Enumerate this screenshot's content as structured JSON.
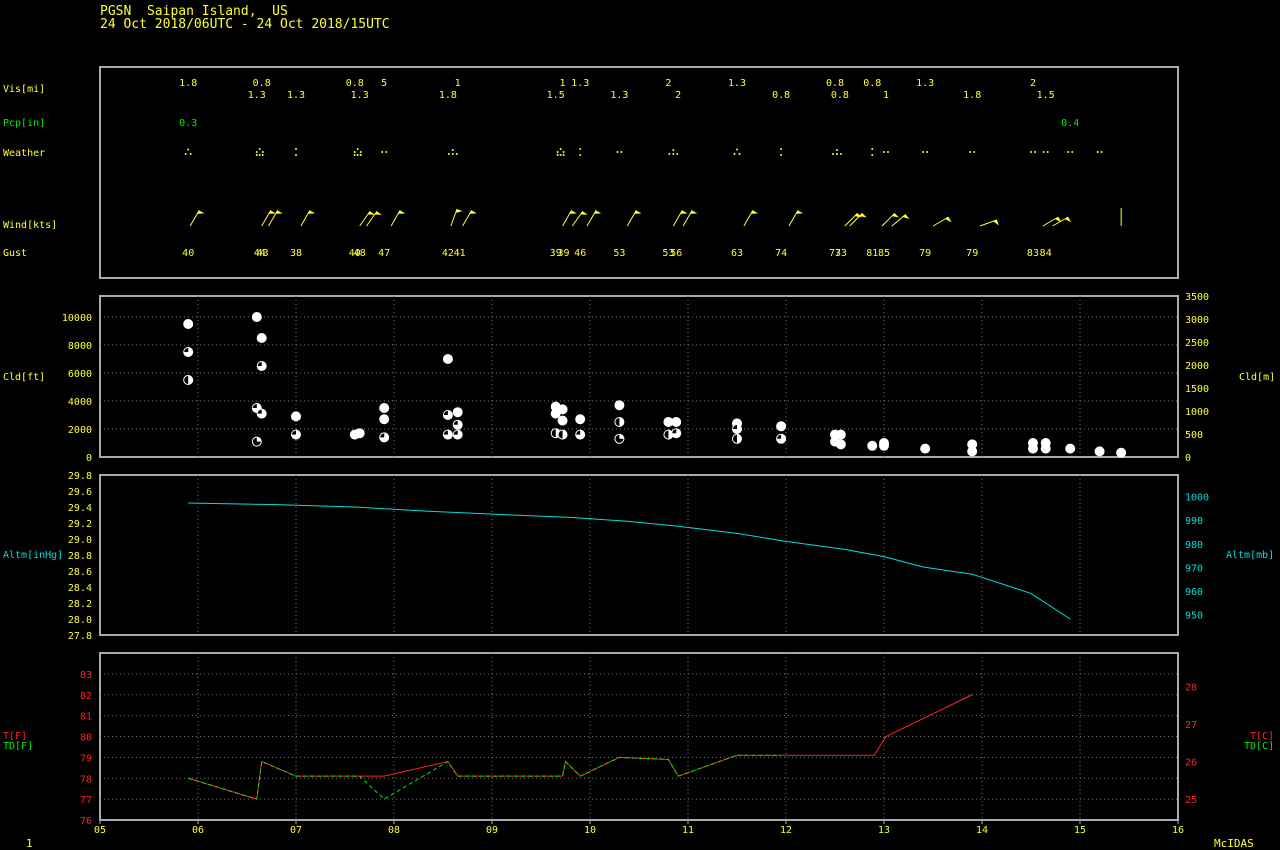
{
  "header": {
    "station_line": "PGSN  Saipan Island,  US",
    "time_line": "24 Oct 2018/06UTC - 24 Oct 2018/15UTC"
  },
  "footer": {
    "left": "1",
    "right": "McIDAS"
  },
  "colors": {
    "axis_text": "#ffff33",
    "frame": "#aaaaaa",
    "grid": "#777777",
    "precip": "#00ee00",
    "altimeter": "#00dddd",
    "temperature": "#ff2222",
    "dewpoint": "#00ee00",
    "cloud": "#ffffff"
  },
  "x_axis": {
    "range": [
      5,
      16
    ],
    "ticks": [
      "05",
      "06",
      "07",
      "08",
      "09",
      "10",
      "11",
      "12",
      "13",
      "14",
      "15",
      "16"
    ]
  },
  "chart_data": [
    {
      "type": "table",
      "name": "surface-observations",
      "labels": {
        "vis": "Vis[mi]",
        "pcp": "Pcp[in]",
        "weather": "Weather",
        "wind": "Wind[kts]",
        "gust": "Gust"
      },
      "visibility": [
        {
          "t": 5.9,
          "v": "1.8",
          "row": 0
        },
        {
          "t": 6.65,
          "v": "0.8",
          "row": 0
        },
        {
          "t": 6.6,
          "v": "1.3",
          "row": 1
        },
        {
          "t": 7.0,
          "v": "1.3",
          "row": 1
        },
        {
          "t": 7.6,
          "v": "0.8",
          "row": 0
        },
        {
          "t": 7.9,
          "v": "5",
          "row": 0
        },
        {
          "t": 7.65,
          "v": "1.3",
          "row": 1
        },
        {
          "t": 8.65,
          "v": "1",
          "row": 0
        },
        {
          "t": 8.55,
          "v": "1.8",
          "row": 1
        },
        {
          "t": 9.72,
          "v": "1",
          "row": 0
        },
        {
          "t": 9.9,
          "v": "1.3",
          "row": 0
        },
        {
          "t": 9.65,
          "v": "1.5",
          "row": 1
        },
        {
          "t": 10.3,
          "v": "1.3",
          "row": 1
        },
        {
          "t": 10.8,
          "v": "2",
          "row": 0
        },
        {
          "t": 10.9,
          "v": "2",
          "row": 1
        },
        {
          "t": 11.5,
          "v": "1.3",
          "row": 0
        },
        {
          "t": 11.95,
          "v": "0.8",
          "row": 1
        },
        {
          "t": 12.5,
          "v": "0.8",
          "row": 0
        },
        {
          "t": 12.55,
          "v": "0.8",
          "row": 1
        },
        {
          "t": 12.88,
          "v": "0.8",
          "row": 0
        },
        {
          "t": 13.02,
          "v": "1",
          "row": 1
        },
        {
          "t": 13.42,
          "v": "1.3",
          "row": 0
        },
        {
          "t": 13.9,
          "v": "1.8",
          "row": 1
        },
        {
          "t": 14.52,
          "v": "2",
          "row": 0
        },
        {
          "t": 14.65,
          "v": "1.5",
          "row": 1
        }
      ],
      "precip": [
        {
          "t": 5.9,
          "v": "0.3"
        },
        {
          "t": 14.9,
          "v": "0.4"
        }
      ],
      "weather": [
        {
          "t": 5.9,
          "sym": "light-rain-icon"
        },
        {
          "t": 6.63,
          "sym": "rain-icon"
        },
        {
          "t": 7.0,
          "sym": "moderate-rain-icon"
        },
        {
          "t": 7.63,
          "sym": "rain-icon"
        },
        {
          "t": 7.9,
          "sym": "drizzle-icon"
        },
        {
          "t": 8.6,
          "sym": "rain-showers-icon"
        },
        {
          "t": 9.7,
          "sym": "rain-icon"
        },
        {
          "t": 9.9,
          "sym": "moderate-rain-icon"
        },
        {
          "t": 10.3,
          "sym": "drizzle-icon"
        },
        {
          "t": 10.85,
          "sym": "rain-showers-icon"
        },
        {
          "t": 11.5,
          "sym": "light-rain-icon"
        },
        {
          "t": 11.95,
          "sym": "moderate-rain-icon"
        },
        {
          "t": 12.52,
          "sym": "rain-showers-icon"
        },
        {
          "t": 12.88,
          "sym": "moderate-rain-icon"
        },
        {
          "t": 13.02,
          "sym": "drizzle-icon"
        },
        {
          "t": 13.42,
          "sym": "drizzle-icon"
        },
        {
          "t": 13.9,
          "sym": "drizzle-icon"
        },
        {
          "t": 14.52,
          "sym": "drizzle-icon"
        },
        {
          "t": 14.65,
          "sym": "drizzle-icon"
        },
        {
          "t": 14.9,
          "sym": "drizzle-icon"
        },
        {
          "t": 15.2,
          "sym": "drizzle-icon"
        }
      ],
      "wind": [
        {
          "t": 5.92,
          "dir": 30
        },
        {
          "t": 6.65,
          "dir": 30
        },
        {
          "t": 6.72,
          "dir": 30
        },
        {
          "t": 7.05,
          "dir": 30
        },
        {
          "t": 7.65,
          "dir": 35
        },
        {
          "t": 7.72,
          "dir": 35
        },
        {
          "t": 7.97,
          "dir": 30
        },
        {
          "t": 8.58,
          "dir": 20
        },
        {
          "t": 8.7,
          "dir": 30
        },
        {
          "t": 9.72,
          "dir": 30
        },
        {
          "t": 9.82,
          "dir": 35
        },
        {
          "t": 9.97,
          "dir": 30
        },
        {
          "t": 10.38,
          "dir": 30
        },
        {
          "t": 10.85,
          "dir": 30
        },
        {
          "t": 10.95,
          "dir": 30
        },
        {
          "t": 11.57,
          "dir": 30
        },
        {
          "t": 12.03,
          "dir": 30
        },
        {
          "t": 12.6,
          "dir": 45
        },
        {
          "t": 12.65,
          "dir": 45
        },
        {
          "t": 12.98,
          "dir": 45
        },
        {
          "t": 13.08,
          "dir": 50
        },
        {
          "t": 13.5,
          "dir": 60
        },
        {
          "t": 13.98,
          "dir": 70
        },
        {
          "t": 14.62,
          "dir": 60
        },
        {
          "t": 14.72,
          "dir": 60
        },
        {
          "t": 15.42,
          "dir": 0
        }
      ],
      "gust": [
        {
          "t": 5.9,
          "v": "40"
        },
        {
          "t": 6.63,
          "v": "44"
        },
        {
          "t": 6.66,
          "v": "43"
        },
        {
          "t": 7.0,
          "v": "38"
        },
        {
          "t": 7.6,
          "v": "40"
        },
        {
          "t": 7.65,
          "v": "48"
        },
        {
          "t": 7.9,
          "v": "47"
        },
        {
          "t": 8.55,
          "v": "42"
        },
        {
          "t": 8.67,
          "v": "41"
        },
        {
          "t": 9.65,
          "v": "39"
        },
        {
          "t": 9.73,
          "v": "39"
        },
        {
          "t": 9.9,
          "v": "46"
        },
        {
          "t": 10.3,
          "v": "53"
        },
        {
          "t": 10.8,
          "v": "53"
        },
        {
          "t": 10.88,
          "v": "56"
        },
        {
          "t": 11.5,
          "v": "63"
        },
        {
          "t": 11.95,
          "v": "74"
        },
        {
          "t": 12.5,
          "v": "73"
        },
        {
          "t": 12.56,
          "v": "73"
        },
        {
          "t": 12.88,
          "v": "81"
        },
        {
          "t": 13.0,
          "v": "85"
        },
        {
          "t": 13.42,
          "v": "79"
        },
        {
          "t": 13.9,
          "v": "79"
        },
        {
          "t": 14.52,
          "v": "83"
        },
        {
          "t": 14.65,
          "v": "84"
        }
      ]
    },
    {
      "type": "scatter",
      "name": "cloud-heights",
      "ylabel_left": "Cld[ft]",
      "ylabel_right": "Cld[m]",
      "ylim": [
        0,
        11500
      ],
      "yticks_left": [
        0,
        2000,
        4000,
        6000,
        8000,
        10000
      ],
      "yticks_right": [
        0,
        500,
        1000,
        1500,
        2000,
        2500,
        3000,
        3500
      ],
      "points": [
        {
          "t": 5.9,
          "h": 9500,
          "cover": 1.0
        },
        {
          "t": 5.9,
          "h": 7500,
          "cover": 0.75
        },
        {
          "t": 5.9,
          "h": 5500,
          "cover": 0.5
        },
        {
          "t": 6.6,
          "h": 10000,
          "cover": 1.0
        },
        {
          "t": 6.65,
          "h": 8500,
          "cover": 1.0
        },
        {
          "t": 6.65,
          "h": 6500,
          "cover": 0.75
        },
        {
          "t": 6.6,
          "h": 3500,
          "cover": 0.75
        },
        {
          "t": 6.65,
          "h": 3100,
          "cover": 0.75
        },
        {
          "t": 6.6,
          "h": 1100,
          "cover": 0.25
        },
        {
          "t": 7.0,
          "h": 2900,
          "cover": 1.0
        },
        {
          "t": 7.0,
          "h": 1600,
          "cover": 0.75
        },
        {
          "t": 7.6,
          "h": 1600,
          "cover": 1.0
        },
        {
          "t": 7.65,
          "h": 1700,
          "cover": 1.0
        },
        {
          "t": 7.9,
          "h": 3500,
          "cover": 1.0
        },
        {
          "t": 7.9,
          "h": 2700,
          "cover": 1.0
        },
        {
          "t": 7.9,
          "h": 1400,
          "cover": 0.75
        },
        {
          "t": 8.55,
          "h": 7000,
          "cover": 1.0
        },
        {
          "t": 8.55,
          "h": 3000,
          "cover": 0.75
        },
        {
          "t": 8.65,
          "h": 3200,
          "cover": 1.0
        },
        {
          "t": 8.65,
          "h": 2300,
          "cover": 0.75
        },
        {
          "t": 8.55,
          "h": 1600,
          "cover": 0.75
        },
        {
          "t": 8.65,
          "h": 1600,
          "cover": 0.75
        },
        {
          "t": 9.65,
          "h": 3600,
          "cover": 1.0
        },
        {
          "t": 9.72,
          "h": 3400,
          "cover": 1.0
        },
        {
          "t": 9.65,
          "h": 3100,
          "cover": 1.0
        },
        {
          "t": 9.72,
          "h": 2600,
          "cover": 1.0
        },
        {
          "t": 9.65,
          "h": 1700,
          "cover": 0.5
        },
        {
          "t": 9.72,
          "h": 1600,
          "cover": 0.5
        },
        {
          "t": 9.9,
          "h": 2700,
          "cover": 1.0
        },
        {
          "t": 9.9,
          "h": 1600,
          "cover": 0.75
        },
        {
          "t": 10.3,
          "h": 3700,
          "cover": 1.0
        },
        {
          "t": 10.3,
          "h": 2500,
          "cover": 0.5
        },
        {
          "t": 10.3,
          "h": 1300,
          "cover": 0.25
        },
        {
          "t": 10.8,
          "h": 2500,
          "cover": 1.0
        },
        {
          "t": 10.88,
          "h": 2500,
          "cover": 1.0
        },
        {
          "t": 10.8,
          "h": 1600,
          "cover": 0.5
        },
        {
          "t": 10.88,
          "h": 1700,
          "cover": 0.75
        },
        {
          "t": 11.5,
          "h": 2400,
          "cover": 1.0
        },
        {
          "t": 11.5,
          "h": 2000,
          "cover": 0.75
        },
        {
          "t": 11.5,
          "h": 1300,
          "cover": 0.5
        },
        {
          "t": 11.95,
          "h": 2200,
          "cover": 1.0
        },
        {
          "t": 11.95,
          "h": 1300,
          "cover": 0.75
        },
        {
          "t": 12.5,
          "h": 1600,
          "cover": 1.0
        },
        {
          "t": 12.56,
          "h": 1600,
          "cover": 1.0
        },
        {
          "t": 12.5,
          "h": 1100,
          "cover": 1.0
        },
        {
          "t": 12.56,
          "h": 900,
          "cover": 1.0
        },
        {
          "t": 12.88,
          "h": 800,
          "cover": 1.0
        },
        {
          "t": 13.0,
          "h": 1000,
          "cover": 1.0
        },
        {
          "t": 13.0,
          "h": 800,
          "cover": 1.0
        },
        {
          "t": 13.42,
          "h": 600,
          "cover": 1.0
        },
        {
          "t": 13.9,
          "h": 900,
          "cover": 1.0
        },
        {
          "t": 13.9,
          "h": 400,
          "cover": 1.0
        },
        {
          "t": 14.52,
          "h": 1000,
          "cover": 1.0
        },
        {
          "t": 14.65,
          "h": 1000,
          "cover": 1.0
        },
        {
          "t": 14.52,
          "h": 600,
          "cover": 1.0
        },
        {
          "t": 14.65,
          "h": 600,
          "cover": 1.0
        },
        {
          "t": 14.9,
          "h": 600,
          "cover": 1.0
        },
        {
          "t": 15.2,
          "h": 400,
          "cover": 1.0
        },
        {
          "t": 15.42,
          "h": 300,
          "cover": 1.0
        }
      ]
    },
    {
      "type": "line",
      "name": "altimeter",
      "ylabel_left": "Altm[inHg]",
      "ylabel_right": "Altm[mb]",
      "ylim": [
        27.8,
        29.8
      ],
      "yticks_left": [
        "27.8",
        "28.0",
        "28.2",
        "28.4",
        "28.6",
        "28.8",
        "29.0",
        "29.2",
        "29.4",
        "29.6",
        "29.8"
      ],
      "yticks_right": [
        950,
        960,
        970,
        980,
        990,
        1000
      ],
      "series": [
        {
          "x": [
            5.9,
            6.3,
            6.8,
            7.6,
            8.3,
            9.2,
            9.8,
            10.4,
            10.9,
            11.5,
            12.0,
            12.6,
            13.0,
            13.4,
            13.9,
            14.5,
            14.9
          ],
          "y": [
            29.45,
            29.44,
            29.43,
            29.4,
            29.35,
            29.3,
            29.27,
            29.22,
            29.16,
            29.07,
            28.97,
            28.87,
            28.78,
            28.65,
            28.56,
            28.32,
            28.0
          ]
        }
      ]
    },
    {
      "type": "line",
      "name": "temperature-dewpoint",
      "ylabel_left_t": "T[F]",
      "ylabel_left_td": "TD[F]",
      "ylabel_right_t": "T[C]",
      "ylabel_right_td": "TD[C]",
      "ylim": [
        76,
        84
      ],
      "yticks_left": [
        76,
        77,
        78,
        79,
        80,
        81,
        82,
        83
      ],
      "yticks_right": [
        25,
        26,
        27,
        28
      ],
      "series": [
        {
          "key": "temperature",
          "x": [
            5.9,
            6.6,
            6.65,
            7.0,
            7.65,
            7.9,
            8.55,
            8.65,
            9.72,
            9.75,
            9.9,
            10.3,
            10.8,
            10.9,
            11.5,
            11.95,
            12.9,
            13.02,
            13.9
          ],
          "y": [
            78,
            77,
            78.8,
            78.1,
            78.1,
            78.1,
            78.8,
            78.1,
            78.1,
            78.8,
            78.1,
            79,
            78.9,
            78.1,
            79.1,
            79.1,
            79.1,
            80,
            82
          ]
        },
        {
          "key": "dewpoint",
          "x": [
            5.9,
            6.6,
            6.65,
            7.0,
            7.65,
            7.9,
            8.55,
            8.65,
            9.72,
            9.75,
            9.9,
            10.3,
            10.8,
            10.9,
            11.5,
            11.95
          ],
          "y": [
            78,
            77,
            78.8,
            78.1,
            78.1,
            77,
            78.8,
            78.1,
            78.1,
            78.8,
            78.1,
            79,
            78.9,
            78.1,
            79.1,
            79.1
          ]
        }
      ]
    }
  ]
}
